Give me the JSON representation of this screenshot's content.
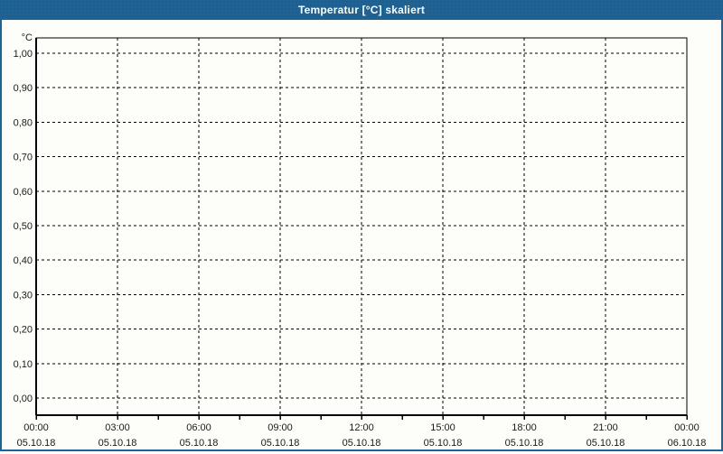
{
  "window": {
    "title": "Temperatur [°C] skaliert"
  },
  "colors": {
    "titlebar_bg": "#1f6394",
    "frame": "#1f6394",
    "title_text": "#ffffff",
    "plot_bg": "#fdfdf9",
    "grid": "#000000",
    "axis": "#000000",
    "tick_text": "#1a1a1a"
  },
  "chart_data": {
    "type": "line",
    "title": "Temperatur [°C] skaliert",
    "unit_label": "°C",
    "grid": "dashed",
    "legend": "none",
    "series": [],
    "y_axis": {
      "min": 0.0,
      "max": 1.0,
      "step": 0.1,
      "tick_labels_top_to_bottom": [
        "1,00",
        "0,90",
        "0,80",
        "0,70",
        "0,60",
        "0,50",
        "0,40",
        "0,30",
        "0,20",
        "0,10",
        "0,00"
      ]
    },
    "x_axis": {
      "minor_ticks_between_major": 1,
      "major_ticks": [
        {
          "time": "00:00",
          "date": "05.10.18"
        },
        {
          "time": "03:00",
          "date": "05.10.18"
        },
        {
          "time": "06:00",
          "date": "05.10.18"
        },
        {
          "time": "09:00",
          "date": "05.10.18"
        },
        {
          "time": "12:00",
          "date": "05.10.18"
        },
        {
          "time": "15:00",
          "date": "05.10.18"
        },
        {
          "time": "18:00",
          "date": "05.10.18"
        },
        {
          "time": "21:00",
          "date": "05.10.18"
        },
        {
          "time": "00:00",
          "date": "06.10.18"
        }
      ]
    }
  }
}
